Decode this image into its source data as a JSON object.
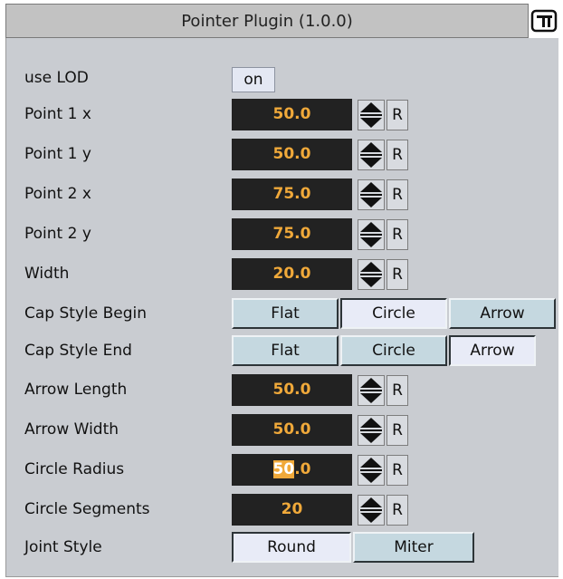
{
  "header": {
    "title": "Pointer Plugin (1.0.0)",
    "icon": "plugin-icon"
  },
  "colors": {
    "panel_bg": "#c9ccd1",
    "field_bg": "#222222",
    "field_text": "#f0a93a",
    "button_off": "#c5d8e0",
    "button_on": "#e8ebf7"
  },
  "fields": {
    "use_lod": {
      "label": "use LOD",
      "value": "on"
    },
    "point1x": {
      "label": "Point 1 x",
      "value": "50.0",
      "reset": "R"
    },
    "point1y": {
      "label": "Point 1 y",
      "value": "50.0",
      "reset": "R"
    },
    "point2x": {
      "label": "Point 2 x",
      "value": "75.0",
      "reset": "R"
    },
    "point2y": {
      "label": "Point 2 y",
      "value": "75.0",
      "reset": "R"
    },
    "width": {
      "label": "Width",
      "value": "20.0",
      "reset": "R"
    },
    "cap_begin": {
      "label": "Cap Style Begin",
      "options": [
        "Flat",
        "Circle",
        "Arrow"
      ],
      "selected": "Circle"
    },
    "cap_end": {
      "label": "Cap Style End",
      "options": [
        "Flat",
        "Circle",
        "Arrow"
      ],
      "selected": "Arrow"
    },
    "arrow_length": {
      "label": "Arrow Length",
      "value": "50.0",
      "reset": "R"
    },
    "arrow_width": {
      "label": "Arrow Width",
      "value": "50.0",
      "reset": "R"
    },
    "circle_radius": {
      "label": "Circle Radius",
      "value_selected": "50",
      "value_rest": ".0",
      "reset": "R"
    },
    "circle_segments": {
      "label": "Circle Segments",
      "value": "20",
      "reset": "R"
    },
    "joint_style": {
      "label": "Joint Style",
      "options": [
        "Round",
        "Miter"
      ],
      "selected": "Round"
    }
  }
}
